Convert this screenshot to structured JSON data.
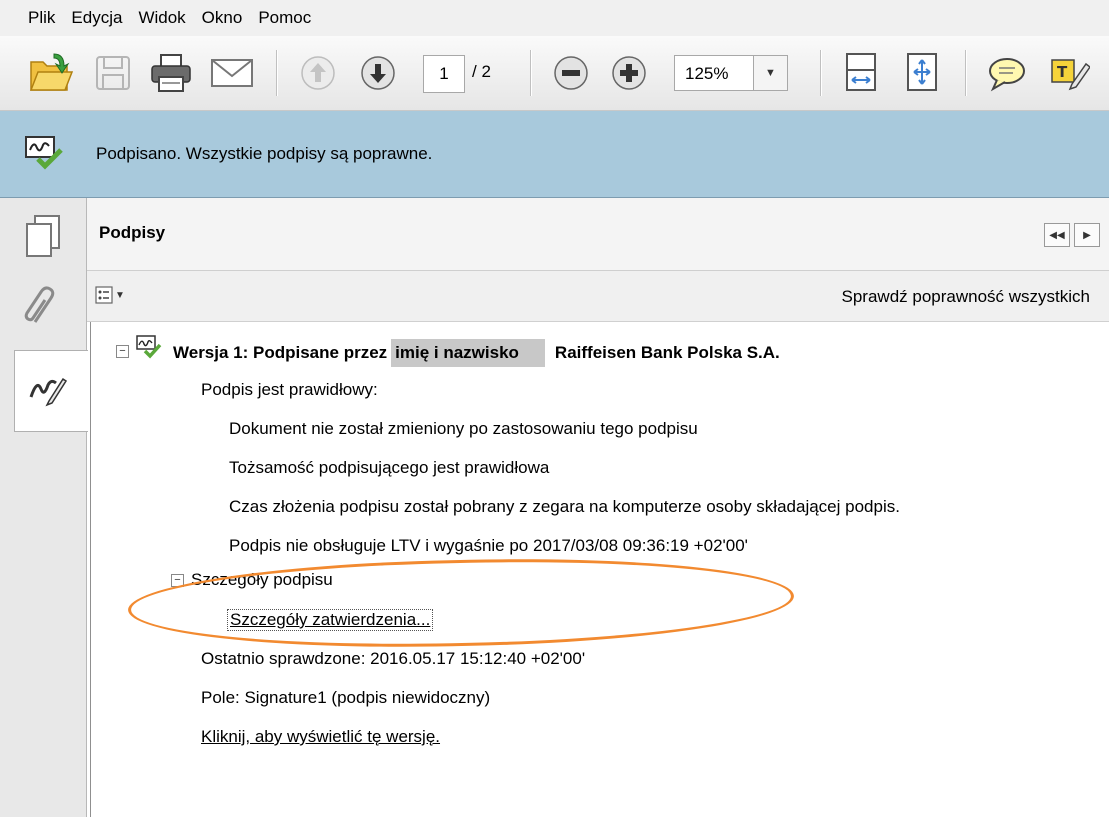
{
  "menu": [
    "Plik",
    "Edycja",
    "Widok",
    "Okno",
    "Pomoc"
  ],
  "toolbar": {
    "page_current": "1",
    "page_total": "/ 2",
    "zoom": "125%",
    "icons": [
      "open-icon",
      "save-icon",
      "print-icon",
      "email-icon",
      "previous-page-icon",
      "next-page-icon",
      "zoom-out-icon",
      "zoom-in-icon",
      "fit-width-icon",
      "fit-page-icon",
      "comment-icon",
      "highlight-icon"
    ]
  },
  "infobar": {
    "message": "Podpisano. Wszystkie podpisy są poprawne."
  },
  "panel": {
    "title": "Podpisy",
    "validate_all": "Sprawdź poprawność wszystkich"
  },
  "signature": {
    "version_prefix": "Wersja 1: Podpisane przez",
    "signer_redacted": "imię i nazwisko",
    "signer_org": "Raiffeisen Bank Polska S.A.",
    "status": "Podpis jest prawidłowy:",
    "checks": [
      "Dokument nie został zmieniony po zastosowaniu tego podpisu",
      "Tożsamość podpisującego jest prawidłowa",
      "Czas złożenia podpisu został pobrany z zegara na komputerze osoby składającej podpis.",
      "Podpis nie obsługuje LTV i wygaśnie po 2017/03/08 09:36:19 +02'00'"
    ],
    "details_label": "Szczegóły podpisu",
    "details_link": "Szczegóły zatwierdzenia...",
    "last_checked": "Ostatnio sprawdzone: 2016.05.17 15:12:40 +02'00'",
    "field": "Pole: Signature1 (podpis niewidoczny)",
    "view_version": "Kliknij, aby wyświetlić tę wersję."
  },
  "colors": {
    "infobar_bg": "#a8c9dc",
    "annotation_orange": "#f28a30",
    "check_green": "#5aa83a"
  }
}
